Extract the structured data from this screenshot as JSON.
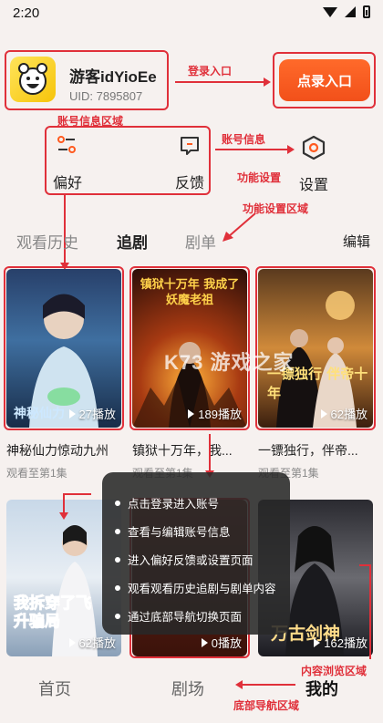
{
  "status_bar": {
    "time": "2:20"
  },
  "account": {
    "username": "游客idYioEe",
    "uid": "UID: 7895807",
    "login_button": "点录入口"
  },
  "functions": {
    "preference": "偏好",
    "feedback": "反馈",
    "settings": "设置"
  },
  "annotations": {
    "login_entry": "登录入口",
    "account_area": "账号信息区域",
    "account_info": "账号信息",
    "func_settings": "功能设置",
    "func_area": "功能设置区域",
    "content_area": "内容浏览区域",
    "bottom_nav_area": "底部导航区域"
  },
  "tabs": [
    {
      "label": "观看历史"
    },
    {
      "label": "追剧"
    },
    {
      "label": "剧单"
    }
  ],
  "edit_label": "编辑",
  "dramas": [
    {
      "title": "神秘仙力惊动九州",
      "plays": "27播放",
      "watched": "观看至第1集",
      "poster_text": "神秘仙力"
    },
    {
      "title": "镇狱十万年，我...",
      "plays": "189播放",
      "watched": "观看至第1集",
      "poster_text": "镇狱十万年 我成了妖魔老祖"
    },
    {
      "title": "一镖独行，伴帝...",
      "plays": "62播放",
      "watched": "观看至第1集",
      "poster_text": "一镖独行 伴帝十年"
    },
    {
      "title": "",
      "plays": "62播放",
      "watched": "",
      "poster_text": "我拆穿了飞升骗局"
    },
    {
      "title": "",
      "plays": "0播放",
      "watched": "",
      "poster_text": ""
    },
    {
      "title": "",
      "plays": "162播放",
      "watched": "",
      "poster_text": "万古剑神"
    }
  ],
  "overlay_tips": [
    "点击登录进入账号",
    "查看与编辑账号信息",
    "进入偏好反馈或设置页面",
    "观看观看历史追剧与剧单内容",
    "通过底部导航切换页面"
  ],
  "watermark": "K73 游戏之家",
  "bottom_nav": [
    {
      "label": "首页"
    },
    {
      "label": "剧场"
    },
    {
      "label": "我的"
    }
  ],
  "colors": {
    "accent": "#f2501a",
    "annotation": "#e0303a"
  }
}
